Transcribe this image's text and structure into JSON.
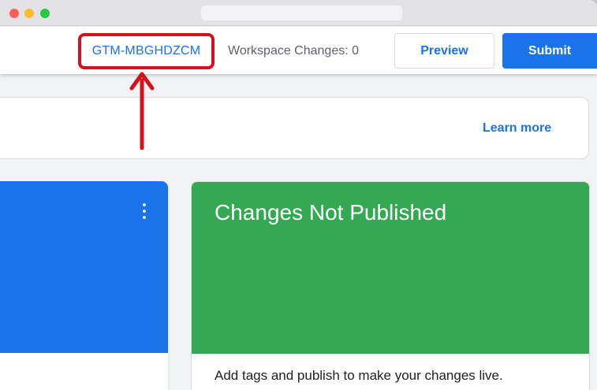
{
  "header": {
    "container_id": "GTM-MBGHDZCM",
    "workspace_changes_label": "Workspace Changes: 0",
    "preview_label": "Preview",
    "submit_label": "Submit"
  },
  "info_banner": {
    "learn_more_label": "Learn more"
  },
  "status_card": {
    "title": "Changes Not Published",
    "description": "Add tags and publish to make your changes live."
  },
  "colors": {
    "accent_blue": "#1a73e8",
    "status_green": "#34a853",
    "annotation_red": "#d3121d"
  },
  "annotation": {
    "highlight": "red-box-around-container-id",
    "pointer": "red-arrow-up"
  }
}
